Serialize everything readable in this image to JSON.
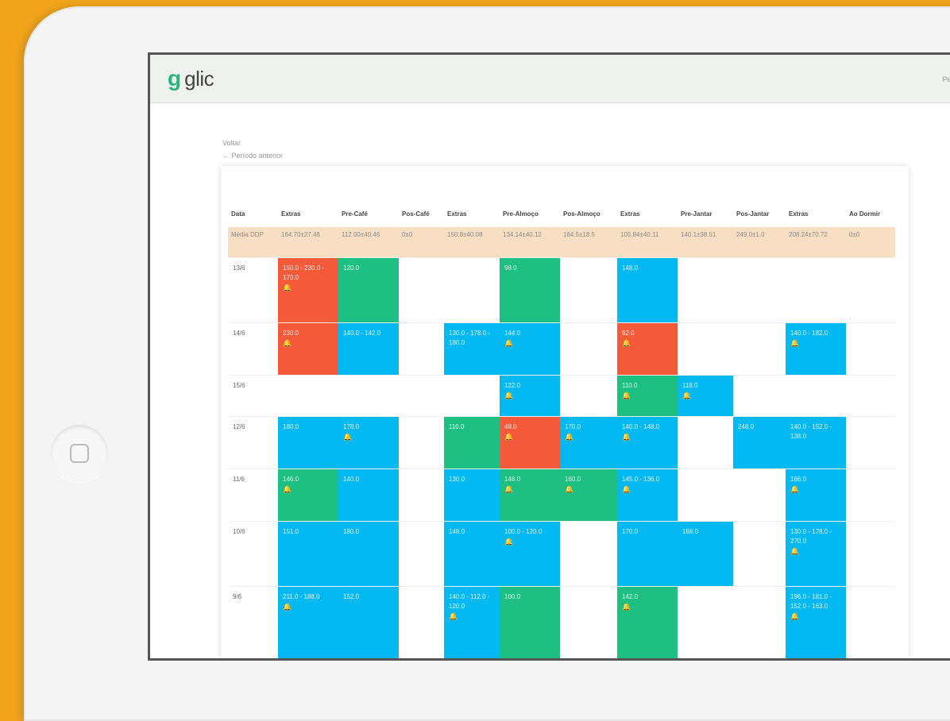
{
  "app": {
    "logo_mark": "g",
    "logo_text": "glic",
    "header_link": "Perfil"
  },
  "nav": {
    "back": "Voltar",
    "previous": "← Período anterior"
  },
  "table": {
    "headers": [
      "Data",
      "Extras",
      "Pre-Café",
      "Pos-Café",
      "Extras",
      "Pre-Almoço",
      "Pos-Almoço",
      "Extras",
      "Pre-Jantar",
      "Pos-Jantar",
      "Extras",
      "Ao Dormir"
    ],
    "saldo": [
      "Média DDP",
      "164.70±27.46",
      "112.00±40.46",
      "0±0",
      "150.8±40.08",
      "134.14±40.12",
      "164.5±18.5",
      "105.84±40.11",
      "140.1±38.51",
      "249.0±1.0",
      "208.24±70.72",
      "0±0"
    ],
    "rows": [
      {
        "date": "13/6",
        "cells": [
          [
            "r",
            "150.0 - 230.0 - 170.0",
            true
          ],
          [
            "g",
            "120.0",
            false
          ],
          [
            "",
            ""
          ],
          [
            "",
            ""
          ],
          [
            "g",
            "98.0",
            false
          ],
          [
            "",
            ""
          ],
          [
            "b",
            "148.0",
            false
          ],
          [
            "",
            ""
          ],
          [
            "",
            ""
          ],
          [
            "",
            ""
          ],
          [
            "",
            ""
          ]
        ]
      },
      {
        "date": "14/6",
        "cells": [
          [
            "r",
            "230.0",
            true
          ],
          [
            "b",
            "140.0 - 142.0",
            false
          ],
          [
            "",
            ""
          ],
          [
            "b",
            "130.0 - 178.0 - 180.0",
            false
          ],
          [
            "b",
            "144.0",
            true
          ],
          [
            "",
            ""
          ],
          [
            "r",
            "62.0",
            true
          ],
          [
            "",
            ""
          ],
          [
            "",
            ""
          ],
          [
            "b",
            "140.0 - 182.0",
            true
          ],
          [
            "",
            ""
          ]
        ]
      },
      {
        "date": "15/6",
        "cells": [
          [
            "",
            ""
          ],
          [
            "",
            ""
          ],
          [
            "",
            ""
          ],
          [
            "",
            ""
          ],
          [
            "b",
            "122.0",
            true
          ],
          [
            "",
            ""
          ],
          [
            "g",
            "110.0",
            true
          ],
          [
            "b",
            "118.0",
            true
          ],
          [
            "",
            ""
          ],
          [
            "",
            ""
          ],
          [
            "",
            ""
          ]
        ]
      },
      {
        "date": "12/6",
        "cells": [
          [
            "b",
            "180.0",
            false
          ],
          [
            "b",
            "178.0",
            true
          ],
          [
            "",
            ""
          ],
          [
            "g",
            "110.0",
            false
          ],
          [
            "r",
            "48.0",
            true
          ],
          [
            "b",
            "170.0",
            true
          ],
          [
            "b",
            "140.0 - 148.0",
            true
          ],
          [
            "",
            ""
          ],
          [
            "b",
            "248.0",
            false
          ],
          [
            "b",
            "140.0 - 152.0 - 138.0",
            false
          ],
          [
            "",
            ""
          ]
        ]
      },
      {
        "date": "11/6",
        "cells": [
          [
            "g",
            "146.0",
            true
          ],
          [
            "b",
            "140.0",
            false
          ],
          [
            "",
            ""
          ],
          [
            "b",
            "130.0",
            false
          ],
          [
            "g",
            "148.0",
            true
          ],
          [
            "g",
            "160.0",
            true
          ],
          [
            "b",
            "145.0 - 136.0",
            true
          ],
          [
            "",
            ""
          ],
          [
            "",
            ""
          ],
          [
            "b",
            "166.0",
            true
          ],
          [
            "",
            ""
          ]
        ]
      },
      {
        "date": "10/6",
        "cells": [
          [
            "b",
            "151.0",
            false
          ],
          [
            "b",
            "180.0",
            false
          ],
          [
            "",
            ""
          ],
          [
            "b",
            "148.0",
            false
          ],
          [
            "b",
            "100.0 - 120.0",
            true
          ],
          [
            "",
            ""
          ],
          [
            "b",
            "170.0",
            false
          ],
          [
            "b",
            "168.0",
            false
          ],
          [
            "",
            ""
          ],
          [
            "b",
            "130.0 - 178.0 - 270.0",
            true
          ],
          [
            "",
            ""
          ]
        ]
      },
      {
        "date": "9/6",
        "cells": [
          [
            "b",
            "211.0 - 188.0",
            true
          ],
          [
            "b",
            "152.0",
            false
          ],
          [
            "",
            ""
          ],
          [
            "b",
            "140.0 - 112.0 - 120.0",
            true
          ],
          [
            "g",
            "100.0",
            false
          ],
          [
            "",
            ""
          ],
          [
            "g",
            "142.0",
            true
          ],
          [
            "",
            ""
          ],
          [
            "",
            ""
          ],
          [
            "b",
            "196.0 - 181.0 - 152.0 - 163.0",
            true
          ],
          [
            "",
            ""
          ]
        ]
      }
    ]
  }
}
